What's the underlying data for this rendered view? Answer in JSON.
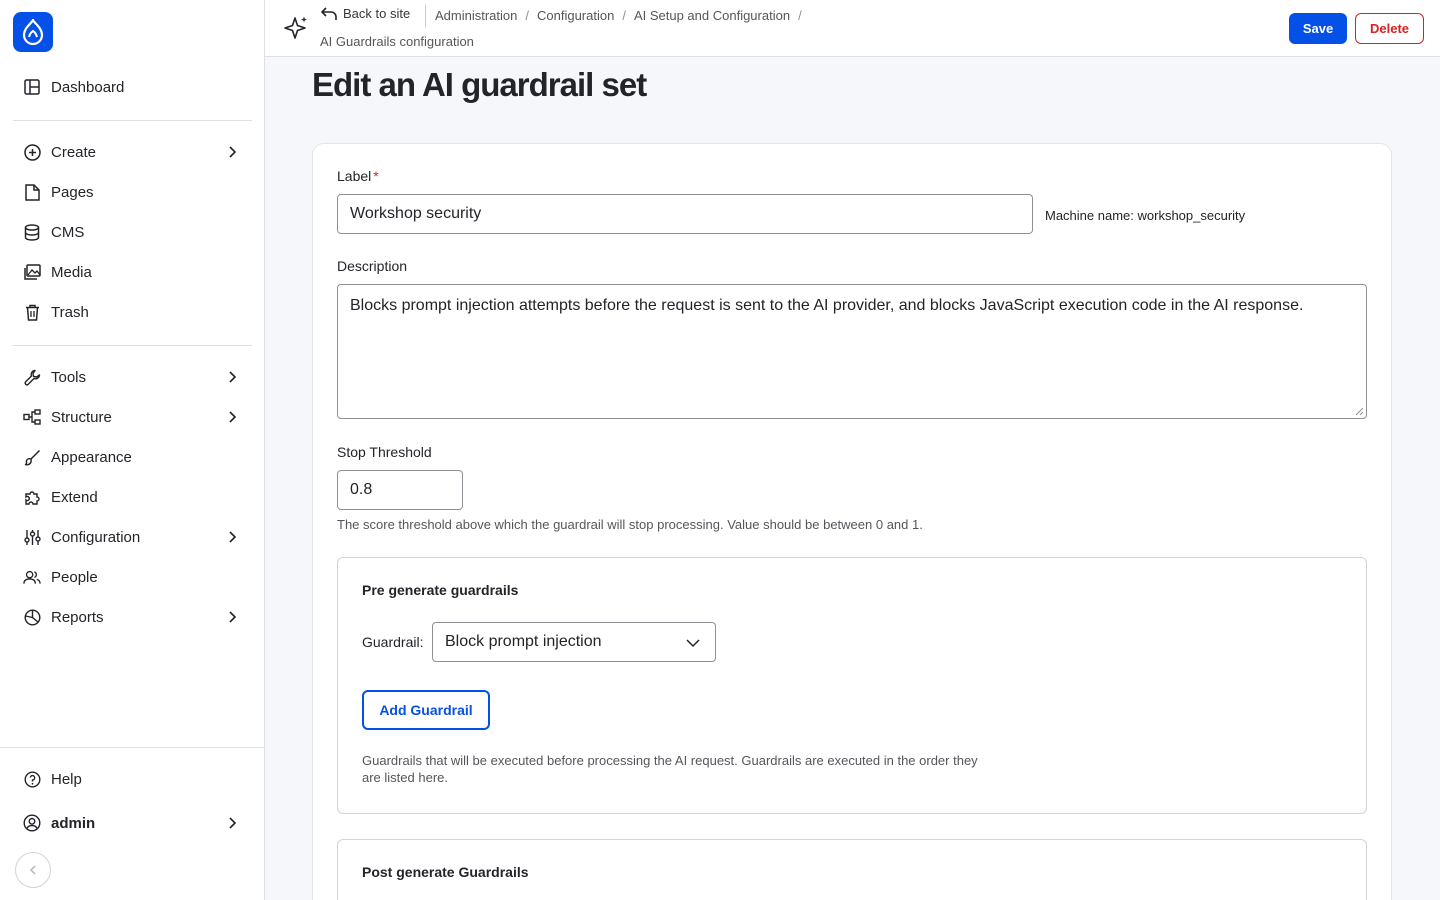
{
  "sidebar": {
    "items": [
      {
        "label": "Dashboard",
        "icon": "dashboard-icon"
      },
      {
        "label": "Create",
        "icon": "plus-circle-icon"
      },
      {
        "label": "Pages",
        "icon": "page-icon"
      },
      {
        "label": "CMS",
        "icon": "database-icon"
      },
      {
        "label": "Media",
        "icon": "image-icon"
      },
      {
        "label": "Trash",
        "icon": "trash-icon"
      },
      {
        "label": "Tools",
        "icon": "wrench-icon"
      },
      {
        "label": "Structure",
        "icon": "structure-icon"
      },
      {
        "label": "Appearance",
        "icon": "brush-icon"
      },
      {
        "label": "Extend",
        "icon": "puzzle-icon"
      },
      {
        "label": "Configuration",
        "icon": "sliders-icon"
      },
      {
        "label": "People",
        "icon": "people-icon"
      },
      {
        "label": "Reports",
        "icon": "chart-pie-icon"
      }
    ],
    "help_label": "Help",
    "user_label": "admin"
  },
  "topbar": {
    "back_label": "Back to site",
    "breadcrumbs": [
      "Administration",
      "Configuration",
      "AI Setup and Configuration"
    ],
    "breadcrumb_last": "AI Guardrails configuration",
    "save_label": "Save",
    "delete_label": "Delete"
  },
  "page": {
    "title": "Edit an AI guardrail set"
  },
  "form": {
    "label_label": "Label",
    "label_required": "*",
    "label_value": "Workshop security",
    "machine_name": "Machine name: workshop_security",
    "description_label": "Description",
    "description_value": "Blocks prompt injection attempts before the request is sent to the AI provider, and blocks JavaScript execution code in the AI response.",
    "threshold_label": "Stop Threshold",
    "threshold_value": "0.8",
    "threshold_help": "The score threshold above which the guardrail will stop processing. Value should be between 0 and 1.",
    "pre": {
      "title": "Pre generate guardrails",
      "guardrail_label": "Guardrail:",
      "guardrail_value": "Block prompt injection",
      "add_label": "Add Guardrail",
      "help": "Guardrails that will be executed before processing the AI request. Guardrails are executed in the order they are listed here."
    },
    "post": {
      "title": "Post generate Guardrails"
    }
  },
  "colors": {
    "accent": "#0550e6",
    "danger": "#d72222"
  }
}
